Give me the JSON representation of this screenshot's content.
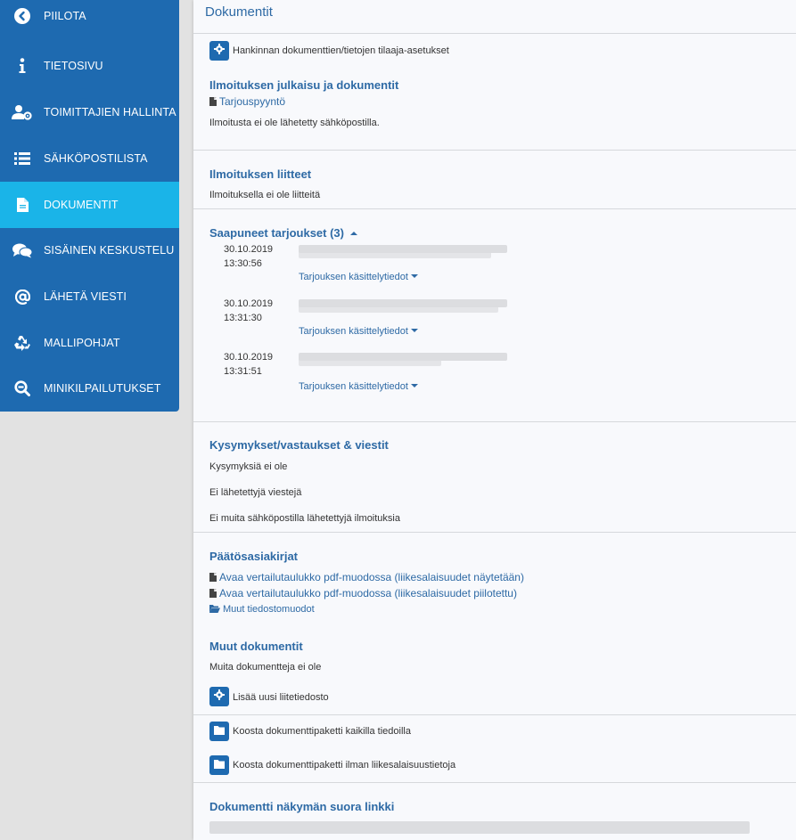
{
  "sidebar": {
    "items": [
      {
        "label": "PIILOTA",
        "icon": "chevron-left-icon"
      },
      {
        "label": "TIETOSIVU",
        "icon": "info-icon"
      },
      {
        "label": "TOIMITTAJIEN HALLINTA",
        "icon": "user-gear-icon"
      },
      {
        "label": "SÄHKÖPOSTILISTA",
        "icon": "list-icon"
      },
      {
        "label": "DOKUMENTIT",
        "icon": "document-icon",
        "active": true
      },
      {
        "label": "SISÄINEN KESKUSTELU",
        "icon": "chat-icon"
      },
      {
        "label": "LÄHETÄ VIESTI",
        "icon": "at-icon"
      },
      {
        "label": "MALLIPOHJAT",
        "icon": "recycle-icon"
      },
      {
        "label": "MINIKILPAILUTUKSET",
        "icon": "search-minus-icon"
      }
    ]
  },
  "main": {
    "title": "Dokumentit",
    "settings_label": "Hankinnan dokumenttien/tietojen tilaaja-asetukset",
    "publication": {
      "title": "Ilmoituksen julkaisu ja dokumentit",
      "link": "Tarjouspyyntö",
      "note": "Ilmoitusta ei ole lähetetty sähköpostilla."
    },
    "attachments": {
      "title": "Ilmoituksen liitteet",
      "note": "Ilmoituksella ei ole liitteitä"
    },
    "offers": {
      "title": "Saapuneet tarjoukset (3)",
      "items": [
        {
          "date": "30.10.2019",
          "time": "13:30:56",
          "details": "Tarjouksen käsittelytiedot"
        },
        {
          "date": "30.10.2019",
          "time": "13:31:30",
          "details": "Tarjouksen käsittelytiedot"
        },
        {
          "date": "30.10.2019",
          "time": "13:31:51",
          "details": "Tarjouksen käsittelytiedot"
        }
      ]
    },
    "questions": {
      "title": "Kysymykset/vastaukset & viestit",
      "lines": [
        "Kysymyksiä ei ole",
        "Ei lähetettyjä viestejä",
        "Ei muita sähköpostilla lähetettyjä ilmoituksia"
      ]
    },
    "decisions": {
      "title": "Päätösasiakirjat",
      "links": [
        "Avaa vertailutaulukko pdf-muodossa (liikesalaisuudet näytetään)",
        "Avaa vertailutaulukko pdf-muodossa (liikesalaisuudet piilotettu)"
      ],
      "other_formats": "Muut tiedostomuodot"
    },
    "other_docs": {
      "title": "Muut dokumentit",
      "note": "Muita dokumentteja ei ole",
      "add_label": "Lisää uusi liitetiedosto"
    },
    "packages": {
      "all_label": "Koosta dokumenttipaketti kaikilla tiedoilla",
      "no_secrets_label": "Koosta dokumenttipaketti ilman liikesalaisuustietoja"
    },
    "direct_link": {
      "title": "Dokumentti näkymän suora linkki"
    }
  },
  "colors": {
    "sidebar": "#1e6ab0",
    "sidebar_active": "#1ab4e8",
    "heading": "#2e6aa5"
  }
}
